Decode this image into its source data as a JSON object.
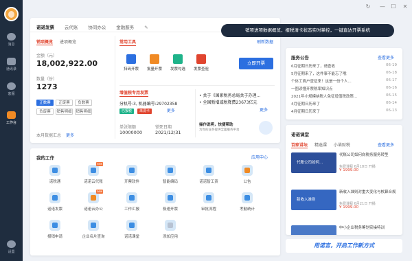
{
  "window": {
    "minimize": "—",
    "maximize": "☐",
    "close": "✕",
    "refresh": "↻"
  },
  "sidebar": {
    "items": [
      {
        "label": "消息",
        "icon": "chat-icon"
      },
      {
        "label": "通讯录",
        "icon": "contacts-icon"
      },
      {
        "label": "客服",
        "icon": "customer-service-icon"
      },
      {
        "label": "工作台",
        "icon": "workbench-icon"
      },
      {
        "label": "设置",
        "icon": "settings-icon"
      }
    ],
    "active_index": 3
  },
  "invoice_panel": {
    "tabs": [
      "诺诺发票",
      "云代账",
      "协同办公",
      "金融服务"
    ],
    "subtabs": [
      "销项概览",
      "进项概览"
    ],
    "amount_label": "金额（元）",
    "amount_value": "18,002,922.00",
    "count_label": "数量（份）",
    "count_value": "1273",
    "ticket_types": [
      "正数票",
      "正废票",
      "负数票",
      "负废票",
      "销售明细",
      "销售明细"
    ],
    "summary_label": "本月数据汇总",
    "more_label": "更多",
    "tools_title": "常用工具",
    "refresh_label": "刷新数据",
    "tools": [
      {
        "label": "扫码开票",
        "icon": "scan-invoice-icon",
        "color": "#2c6fe0"
      },
      {
        "label": "批量开票",
        "icon": "batch-invoice-icon",
        "color": "#f08a24"
      },
      {
        "label": "发票勾选",
        "icon": "invoice-check-icon",
        "color": "#1fb38a"
      },
      {
        "label": "发票查验",
        "icon": "invoice-verify-icon",
        "color": "#e0452f"
      }
    ],
    "open_invoice_button": "立即开票",
    "tax_section_title": "增值税专用发票",
    "tax_info": "分机号:3, 机器编号:29702358",
    "status_uploaded": "已报税",
    "status_not_cleared": "未清卡",
    "tax_limit_label": "单张限额",
    "tax_limit_value": "10000000",
    "lock_date_label": "锁死日期",
    "lock_date_value": "2021/12/31",
    "news": [
      "关于《国家税务总局关于办理...",
      "全国新增减税降费23673亿元"
    ],
    "guide_title": "操作说明，快捷帮助",
    "guide_sub": "为你的业务提供全面服务平台"
  },
  "tooltip": "销项进项数据概览，报税清卡状态实时掌控，一键直达开票系统",
  "work_panel": {
    "title": "我的工作",
    "app_center": "应用中心",
    "items": [
      {
        "label": "诺税通",
        "icon": "nuoshuitong-icon",
        "badge": ""
      },
      {
        "label": "诺诺云代账",
        "icon": "cloud-accounting-icon",
        "badge": "new"
      },
      {
        "label": "开票软件",
        "icon": "invoice-software-icon",
        "badge": ""
      },
      {
        "label": "智能编码",
        "icon": "smart-coding-icon",
        "badge": ""
      },
      {
        "label": "诺诺智工资",
        "icon": "smart-salary-icon",
        "badge": ""
      },
      {
        "label": "公告",
        "icon": "announcement-icon",
        "badge": ""
      },
      {
        "label": "诺诺发票",
        "icon": "nuonuo-invoice-icon",
        "badge": ""
      },
      {
        "label": "诺诺云办公",
        "icon": "cloud-office-icon",
        "badge": "new"
      },
      {
        "label": "工作汇报",
        "icon": "work-report-icon",
        "badge": ""
      },
      {
        "label": "极速开票",
        "icon": "fast-invoice-icon",
        "badge": ""
      },
      {
        "label": "审批流程",
        "icon": "approval-flow-icon",
        "badge": ""
      },
      {
        "label": "考勤统计",
        "icon": "attendance-icon",
        "badge": ""
      },
      {
        "label": "报销申请",
        "icon": "reimbursement-icon",
        "badge": ""
      },
      {
        "label": "企业名片查询",
        "icon": "company-card-icon",
        "badge": ""
      },
      {
        "label": "诺诺课堂",
        "icon": "classroom-icon",
        "badge": ""
      },
      {
        "label": "添加应用",
        "icon": "add-app-icon",
        "badge": ""
      }
    ]
  },
  "announce_panel": {
    "title": "服务公告",
    "more": "查看更多",
    "items": [
      {
        "title": "6月征期日历来了，请查收",
        "date": "06-19"
      },
      {
        "title": "5月征期来了，这件事不能忘了哦",
        "date": "06-18"
      },
      {
        "title": "个体工商户查征来！这是一份个人...",
        "date": "06-17"
      },
      {
        "title": "一图读懂开票税率知识点",
        "date": "06-16"
      },
      {
        "title": "2021年小规模纳税人免征增值税政策...",
        "date": "06-15"
      },
      {
        "title": "4月征期日历来了",
        "date": "06-14"
      },
      {
        "title": "4月征期日历来了",
        "date": "06-13"
      }
    ]
  },
  "class_panel": {
    "title": "诺诺课堂",
    "more": "查看更多",
    "tabs": [
      "百家讲坛",
      "精选课",
      "小诺财税"
    ],
    "courses": [
      {
        "title": "代账公司如何向税务服务转型",
        "meta": "免费课程 6月18日 开播",
        "price": "¥ 1999.00",
        "img_text": "代账公司如何..."
      },
      {
        "title": "新收入准则对重大变化与核算合规",
        "meta": "免费课程 6月21日 开播",
        "price": "¥ 1999.00",
        "img_text": "新收入准则"
      },
      {
        "title": "中小企业税务筹划实操特训",
        "meta": "",
        "price": "",
        "img_text": ""
      }
    ]
  },
  "slogan": "用诺言，开启工作新方式"
}
